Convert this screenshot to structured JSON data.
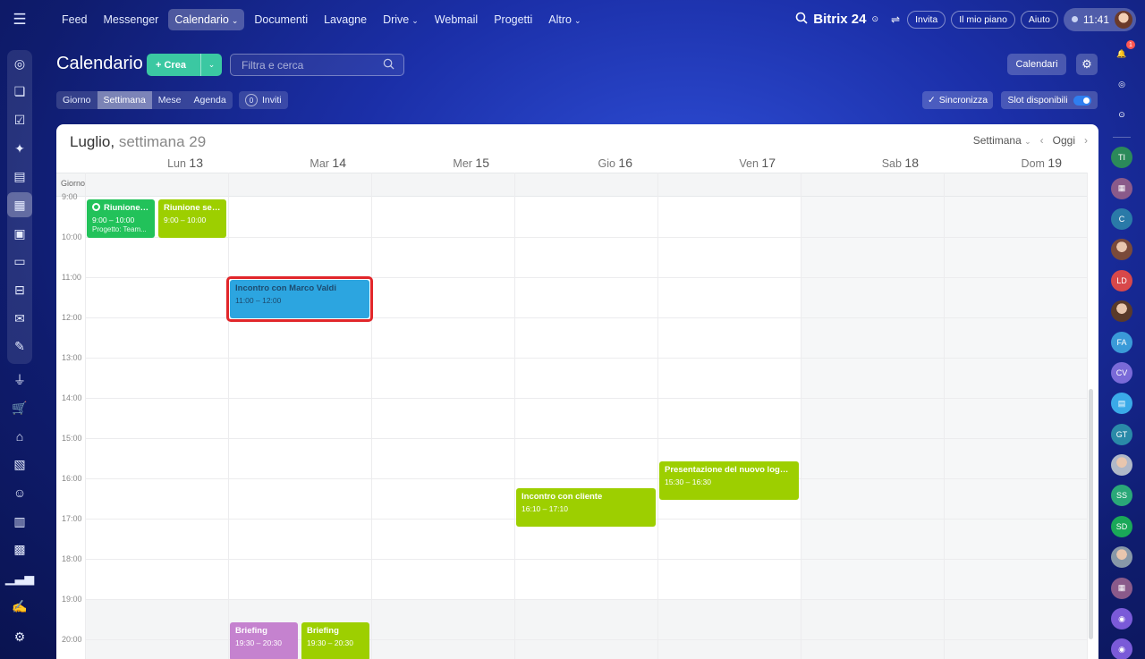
{
  "topbar": {
    "nav": [
      {
        "label": "Feed",
        "caret": false,
        "active": false
      },
      {
        "label": "Messenger",
        "caret": false,
        "active": false
      },
      {
        "label": "Calendario",
        "caret": true,
        "active": true
      },
      {
        "label": "Documenti",
        "caret": false,
        "active": false
      },
      {
        "label": "Lavagne",
        "caret": false,
        "active": false
      },
      {
        "label": "Drive",
        "caret": true,
        "active": false
      },
      {
        "label": "Webmail",
        "caret": false,
        "active": false
      },
      {
        "label": "Progetti",
        "caret": false,
        "active": false
      },
      {
        "label": "Altro",
        "caret": true,
        "active": false
      }
    ],
    "brand": "Bitrix 24",
    "invite_label": "Invita",
    "plan_label": "Il mio piano",
    "help_label": "Aiuto",
    "time": "11:41"
  },
  "header": {
    "title": "Calendario",
    "create_label": "+ Crea",
    "search_placeholder": "Filtra e cerca",
    "calendars_label": "Calendari",
    "views": [
      "Giorno",
      "Settimana",
      "Mese",
      "Agenda"
    ],
    "active_view": "Settimana",
    "invites_count": "0",
    "invites_label": "Inviti",
    "sync_label": "Sincronizza",
    "slots_label": "Slot disponibili"
  },
  "calendar": {
    "month": "Luglio,",
    "week": "settimana 29",
    "mode_label": "Settimana",
    "today_label": "Oggi",
    "allday_label": "Giorno",
    "days": [
      {
        "name": "Lun",
        "num": "13"
      },
      {
        "name": "Mar",
        "num": "14"
      },
      {
        "name": "Mer",
        "num": "15"
      },
      {
        "name": "Gio",
        "num": "16"
      },
      {
        "name": "Ven",
        "num": "17"
      },
      {
        "name": "Sab",
        "num": "18"
      },
      {
        "name": "Dom",
        "num": "19"
      }
    ],
    "hours": [
      "9:00",
      "10:00",
      "11:00",
      "12:00",
      "13:00",
      "14:00",
      "15:00",
      "16:00",
      "17:00",
      "18:00",
      "19:00",
      "20:00"
    ],
    "events": [
      {
        "title": "Riunione ...",
        "time": "9:00 – 10:00",
        "sub": "Progetto: Team...",
        "color": "#22c25a"
      },
      {
        "title": "Riunione set...",
        "time": "9:00 – 10:00",
        "color": "#9dcf00"
      },
      {
        "title": "Incontro con Marco Valdi",
        "time": "11:00 – 12:00",
        "color": "#2ca5e0"
      },
      {
        "title": "Incontro con cliente",
        "time": "16:10 – 17:10",
        "color": "#9dcf00"
      },
      {
        "title": "Presentazione del nuovo logo ...",
        "time": "15:30 – 16:30",
        "color": "#9dcf00"
      },
      {
        "title": "Briefing",
        "time": "19:30 – 20:30",
        "color": "#c582cf"
      },
      {
        "title": "Briefing",
        "time": "19:30 – 20:30",
        "color": "#9dcf00"
      }
    ]
  },
  "rightrail": [
    {
      "name": "notifications-icon",
      "text": "",
      "bg": "transparent"
    },
    {
      "name": "copilot-icon",
      "text": "",
      "bg": "transparent"
    },
    {
      "name": "chat-search-icon",
      "text": "",
      "bg": "transparent"
    },
    {
      "name": "avatar-ti",
      "text": "TI",
      "bg": "#2b8a5a"
    },
    {
      "name": "avatar-calendar",
      "text": "",
      "bg": "#8a5a8a"
    },
    {
      "name": "avatar-c",
      "text": "C",
      "bg": "#2a7aa8"
    },
    {
      "name": "avatar-photo-1",
      "text": "",
      "bg": "#7a4a3a"
    },
    {
      "name": "avatar-ld",
      "text": "LD",
      "bg": "#d8484a"
    },
    {
      "name": "avatar-photo-2",
      "text": "",
      "bg": "#5a3a2a"
    },
    {
      "name": "avatar-fa",
      "text": "FA",
      "bg": "#3a9ad8"
    },
    {
      "name": "avatar-cv",
      "text": "CV",
      "bg": "#7a6ad8"
    },
    {
      "name": "avatar-chat",
      "text": "",
      "bg": "#3aaae8"
    },
    {
      "name": "avatar-gt",
      "text": "GT",
      "bg": "#2a8aa8"
    },
    {
      "name": "avatar-photo-3",
      "text": "",
      "bg": "#b0b8c8"
    },
    {
      "name": "avatar-ss",
      "text": "SS",
      "bg": "#2aa878"
    },
    {
      "name": "avatar-sd",
      "text": "SD",
      "bg": "#1aa858"
    },
    {
      "name": "avatar-photo-4",
      "text": "",
      "bg": "#8898a8"
    },
    {
      "name": "avatar-calendar-2",
      "text": "",
      "bg": "#8a5a8a"
    },
    {
      "name": "avatar-copilot-1",
      "text": "",
      "bg": "#7a5ad8"
    },
    {
      "name": "avatar-copilot-2",
      "text": "",
      "bg": "#7a5ad8"
    }
  ]
}
